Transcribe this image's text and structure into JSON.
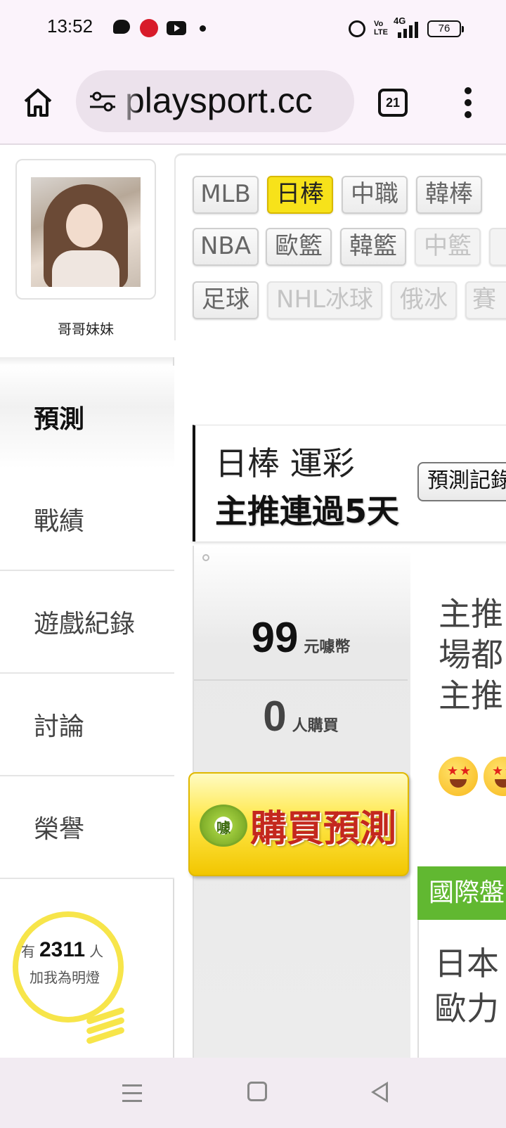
{
  "status_bar": {
    "time": "13:52",
    "network": "4G",
    "volte": "Vo LTE",
    "battery": "76",
    "icons": [
      "chat-icon",
      "app-notification-icon",
      "youtube-icon",
      "dot-icon",
      "alarm-icon",
      "volte-icon",
      "signal-icon",
      "battery-icon"
    ]
  },
  "browser": {
    "url": "playsport.cc",
    "tab_count": "21",
    "icons": [
      "home-icon",
      "site-settings-icon",
      "tabs-icon",
      "more-menu-icon"
    ]
  },
  "profile": {
    "name": "哥哥妹妹"
  },
  "sidebar": {
    "items": [
      {
        "label": "預測",
        "active": true
      },
      {
        "label": "戰績",
        "active": false
      },
      {
        "label": "遊戲紀錄",
        "active": false
      },
      {
        "label": "討論",
        "active": false
      },
      {
        "label": "榮譽",
        "active": false
      }
    ]
  },
  "fans": {
    "prefix": "有",
    "count": "2311",
    "suffix": "人",
    "line2": "加我為明燈"
  },
  "leagues": {
    "row1": [
      {
        "label": "MLB",
        "state": "normal"
      },
      {
        "label": "日棒",
        "state": "active"
      },
      {
        "label": "中職",
        "state": "normal"
      },
      {
        "label": "韓棒",
        "state": "normal"
      }
    ],
    "row2": [
      {
        "label": "NBA",
        "state": "normal"
      },
      {
        "label": "歐籃",
        "state": "normal"
      },
      {
        "label": "韓籃",
        "state": "normal"
      },
      {
        "label": "中籃",
        "state": "disabled"
      }
    ],
    "row3": [
      {
        "label": "足球",
        "state": "normal"
      },
      {
        "label": "NHL冰球",
        "state": "disabled"
      },
      {
        "label": "俄冰",
        "state": "disabled"
      },
      {
        "label": "賽",
        "state": "disabled"
      }
    ]
  },
  "prediction": {
    "title_line1": "日棒 運彩",
    "title_line2": "主推連過5天",
    "record_button": "預測記錄",
    "price": "99",
    "price_unit": "元噱幣",
    "buyers": "0",
    "buyers_unit": "人購買",
    "buy_button": "購買預測",
    "buy_logo": "噱",
    "desc_lines": [
      "主推",
      "場都",
      "主推"
    ],
    "intl_badge": "國際盤",
    "intl_lines": [
      "日本",
      "歐力"
    ]
  },
  "colors": {
    "active_tab": "#f7e21a",
    "buy_text": "#c4281e",
    "intl_badge": "#61b831",
    "bulb": "#f7e54a"
  }
}
